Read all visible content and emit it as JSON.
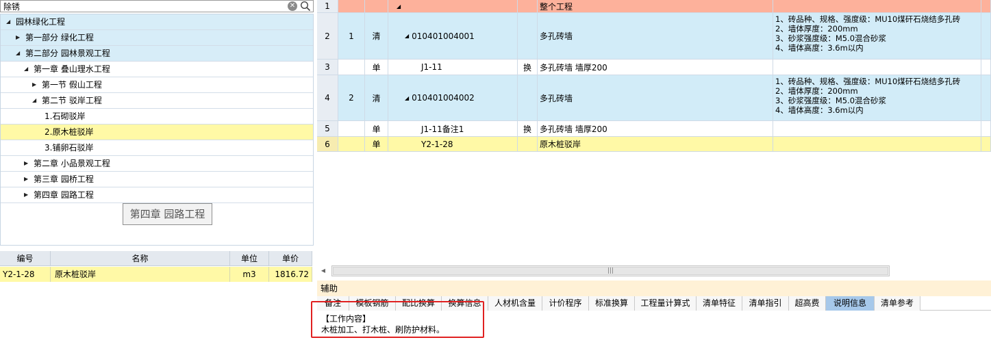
{
  "search": {
    "value": "除锈"
  },
  "tree": {
    "items": [
      {
        "label": "园林绿化工程",
        "arrow": "◢",
        "indent": 8
      },
      {
        "label": "第一部分 绿化工程",
        "arrow": "▶",
        "indent": 22
      },
      {
        "label": "第二部分 园林景观工程",
        "arrow": "◢",
        "indent": 22
      },
      {
        "label": "第一章 叠山理水工程",
        "arrow": "◢",
        "indent": 34
      },
      {
        "label": "第一节 假山工程",
        "arrow": "▶",
        "indent": 46
      },
      {
        "label": "第二节 驳岸工程",
        "arrow": "◢",
        "indent": 46
      },
      {
        "label": "1.石砌驳岸",
        "arrow": "",
        "indent": 64
      },
      {
        "label": "2.原木桩驳岸",
        "arrow": "",
        "indent": 64
      },
      {
        "label": "3.铺卵石驳岸",
        "arrow": "",
        "indent": 64
      },
      {
        "label": "第二章 小品景观工程",
        "arrow": "▶",
        "indent": 34
      },
      {
        "label": "第三章 园桥工程",
        "arrow": "▶",
        "indent": 34
      },
      {
        "label": "第四章 园路工程",
        "arrow": "▶",
        "indent": 34
      }
    ],
    "tooltip": "第四章 园路工程"
  },
  "sub_table": {
    "headers": [
      "编号",
      "名称",
      "单位",
      "单价"
    ],
    "row": [
      "Y2-1-28",
      "原木桩驳岸",
      "m3",
      "1816.72"
    ]
  },
  "grid": {
    "rows": [
      {
        "num": "1",
        "seq": "",
        "type": "",
        "code": "",
        "tri": "◢",
        "conv": "",
        "name": "整个工程",
        "desc": ""
      },
      {
        "num": "2",
        "seq": "1",
        "type": "清",
        "code": "010401004001",
        "tri": "◢",
        "conv": "",
        "name": "多孔砖墙",
        "desc": "1、砖品种、规格、强度级：MU10煤矸石烧结多孔砖\n2、墙体厚度：200mm\n3、砂浆强度级：M5.0混合砂浆\n4、墙体高度：3.6m以内"
      },
      {
        "num": "3",
        "seq": "",
        "type": "单",
        "code": "J1-11",
        "tri": "",
        "conv": "换",
        "name": "多孔砖墙 墙厚200",
        "desc": ""
      },
      {
        "num": "4",
        "seq": "2",
        "type": "清",
        "code": "010401004002",
        "tri": "◢",
        "conv": "",
        "name": "多孔砖墙",
        "desc": "1、砖品种、规格、强度级：MU10煤矸石烧结多孔砖\n2、墙体厚度：200mm\n3、砂浆强度级：M5.0混合砂浆\n4、墙体高度：3.6m以内"
      },
      {
        "num": "5",
        "seq": "",
        "type": "单",
        "code": "J1-11备注1",
        "tri": "",
        "conv": "换",
        "name": "多孔砖墙 墙厚200",
        "desc": ""
      },
      {
        "num": "6",
        "seq": "",
        "type": "单",
        "code": "Y2-1-28",
        "tri": "",
        "conv": "",
        "name": "原木桩驳岸",
        "desc": ""
      }
    ]
  },
  "aux": {
    "title": "辅助",
    "tabs": [
      "备注",
      "模板钢筋",
      "配比换算",
      "换算信息",
      "人材机含量",
      "计价程序",
      "标准换算",
      "工程量计算式",
      "清单特征",
      "清单指引",
      "超高费",
      "说明信息",
      "清单参考"
    ],
    "active_tab": "说明信息",
    "content_title": "【工作内容】",
    "content_body": "木桩加工、打木桩、刷防护材料。"
  },
  "colors": {
    "row_total": "#fdb19b",
    "row_bill": "#d2ecf8",
    "row_selected": "#fff9a6",
    "highlight_box": "#e02020"
  }
}
